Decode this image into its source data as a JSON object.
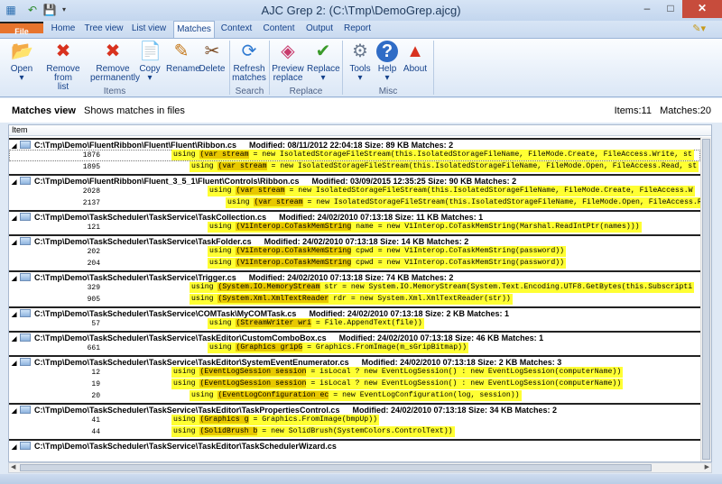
{
  "window": {
    "title": "AJC Grep 2:   (C:\\Tmp\\DemoGrep.ajcg)",
    "minimize": "–",
    "maximize": "□",
    "close": "✕"
  },
  "quick_access": [
    "save-icon",
    "undo-icon",
    "dropdown-icon"
  ],
  "tabs": [
    {
      "label": "File"
    },
    {
      "label": "Home"
    },
    {
      "label": "Tree view"
    },
    {
      "label": "List view"
    },
    {
      "label": "Matches"
    },
    {
      "label": "Context"
    },
    {
      "label": "Content"
    },
    {
      "label": "Output"
    },
    {
      "label": "Report"
    }
  ],
  "ribbon": {
    "items": [
      {
        "label": "Open",
        "label2": "▾",
        "icon": "open-icon",
        "glyph": "📂"
      },
      {
        "label": "Remove from",
        "label2": "list",
        "icon": "remove-icon",
        "glyph": "✖"
      },
      {
        "label": "Remove",
        "label2": "permanently",
        "icon": "delete-permanently-icon",
        "glyph": "✖"
      },
      {
        "label": "Copy",
        "label2": "▾",
        "icon": "copy-icon",
        "glyph": "📄"
      },
      {
        "label": "Rename",
        "label2": "",
        "icon": "rename-icon",
        "glyph": "✎"
      },
      {
        "label": "Delete",
        "label2": "",
        "icon": "delete-icon",
        "glyph": "✂"
      },
      {
        "label": "Refresh",
        "label2": "matches",
        "icon": "refresh-icon",
        "glyph": "⟳"
      },
      {
        "label": "Preview",
        "label2": "replace",
        "icon": "preview-replace-icon",
        "glyph": "◈"
      },
      {
        "label": "Replace",
        "label2": "▾",
        "icon": "replace-icon",
        "glyph": "✔"
      },
      {
        "label": "Tools",
        "label2": "▾",
        "icon": "tools-icon",
        "glyph": "⚙"
      },
      {
        "label": "Help",
        "label2": "▾",
        "icon": "help-icon",
        "glyph": "?"
      },
      {
        "label": "About",
        "label2": "",
        "icon": "about-icon",
        "glyph": "▲"
      }
    ],
    "groups": [
      {
        "label": "Items"
      },
      {
        "label": "Search"
      },
      {
        "label": "Replace"
      },
      {
        "label": "Misc"
      }
    ]
  },
  "view": {
    "title": "Matches view",
    "subtitle": "Shows matches in files",
    "items_count": "Items:11",
    "matches_count": "Matches:20"
  },
  "list": {
    "column_header": "Item",
    "files": [
      {
        "path": "C:\\Tmp\\Demo\\FluentRibbon\\Fluent\\Fluent\\Ribbon.cs",
        "meta": "Modified: 08/11/2012 22:04:18   Size: 89 KB   Matches: 2",
        "matches": [
          {
            "line": "1876",
            "indent": 0,
            "pre": "using ",
            "hl": "(var stream",
            "post": " = new IsolatedStorageFileStream(this.IsolatedStorageFileName, FileMode.Create, FileAccess.Write, st"
          },
          {
            "line": "1895",
            "indent": 1,
            "pre": "using ",
            "hl": "(var stream",
            "post": " = new IsolatedStorageFileStream(this.IsolatedStorageFileName, FileMode.Open, FileAccess.Read, st"
          }
        ]
      },
      {
        "path": "C:\\Tmp\\Demo\\FluentRibbon\\Fluent_3_5_1\\Fluent\\Controls\\Ribbon.cs",
        "meta": "Modified: 03/09/2015 12:35:25   Size: 90 KB   Matches: 2",
        "matches": [
          {
            "line": "2028",
            "indent": 2,
            "pre": "using ",
            "hl": "(var stream",
            "post": " = new IsolatedStorageFileStream(this.IsolatedStorageFileName, FileMode.Create, FileAccess.W"
          },
          {
            "line": "2137",
            "indent": 3,
            "pre": "using ",
            "hl": "(var stream",
            "post": " = new IsolatedStorageFileStream(this.IsolatedStorageFileName, FileMode.Open, FileAccess.R"
          }
        ]
      },
      {
        "path": "C:\\Tmp\\Demo\\TaskScheduler\\TaskService\\TaskCollection.cs",
        "meta": "Modified: 24/02/2010 07:13:18   Size: 11 KB   Matches: 1",
        "matches": [
          {
            "line": "121",
            "indent": 2,
            "pre": "using ",
            "hl": "(V1Interop.CoTaskMemString",
            "post": " name = new V1Interop.CoTaskMemString(Marshal.ReadIntPtr(names)))"
          }
        ]
      },
      {
        "path": "C:\\Tmp\\Demo\\TaskScheduler\\TaskService\\TaskFolder.cs",
        "meta": "Modified: 24/02/2010 07:13:18   Size: 14 KB   Matches: 2",
        "matches": [
          {
            "line": "202",
            "indent": 2,
            "pre": "using ",
            "hl": "(V1Interop.CoTaskMemString",
            "post": " cpwd = new V1Interop.CoTaskMemString(password))"
          },
          {
            "line": "204",
            "indent": 2,
            "pre": "using ",
            "hl": "(V1Interop.CoTaskMemString",
            "post": " cpwd = new V1Interop.CoTaskMemString(password))"
          }
        ]
      },
      {
        "path": "C:\\Tmp\\Demo\\TaskScheduler\\TaskService\\Trigger.cs",
        "meta": "Modified: 24/02/2010 07:13:18   Size: 74 KB   Matches: 2",
        "matches": [
          {
            "line": "329",
            "indent": 1,
            "pre": "using ",
            "hl": "(System.IO.MemoryStream",
            "post": " str = new System.IO.MemoryStream(System.Text.Encoding.UTF8.GetBytes(this.Subscripti"
          },
          {
            "line": "905",
            "indent": 1,
            "pre": "using ",
            "hl": "(System.Xml.XmlTextReader",
            "post": " rdr = new System.Xml.XmlTextReader(str))"
          }
        ]
      },
      {
        "path": "C:\\Tmp\\Demo\\TaskScheduler\\TaskService\\COMTask\\MyCOMTask.cs",
        "meta": "Modified: 24/02/2010 07:13:18   Size: 2 KB   Matches: 1",
        "matches": [
          {
            "line": "57",
            "indent": 2,
            "pre": "using ",
            "hl": "(StreamWriter wri",
            "post": " = File.AppendText(file))"
          }
        ]
      },
      {
        "path": "C:\\Tmp\\Demo\\TaskScheduler\\TaskService\\TaskEditor\\CustomComboBox.cs",
        "meta": "Modified: 24/02/2010 07:13:18   Size: 46 KB   Matches: 1",
        "matches": [
          {
            "line": "661",
            "indent": 2,
            "pre": "using ",
            "hl": "(Graphics gripG",
            "post": " = Graphics.FromImage(m_sGripBitmap))"
          }
        ]
      },
      {
        "path": "C:\\Tmp\\Demo\\TaskScheduler\\TaskService\\TaskEditor\\SystemEventEnumerator.cs",
        "meta": "Modified: 24/02/2010 07:13:18   Size: 2 KB   Matches: 3",
        "matches": [
          {
            "line": "12",
            "indent": 0,
            "pre": "using ",
            "hl": "(EventLogSession session",
            "post": " = isLocal ? new EventLogSession() : new EventLogSession(computerName))"
          },
          {
            "line": "19",
            "indent": 0,
            "pre": "using ",
            "hl": "(EventLogSession session",
            "post": " = isLocal ? new EventLogSession() : new EventLogSession(computerName))"
          },
          {
            "line": "20",
            "indent": 1,
            "pre": "using ",
            "hl": "(EventLogConfiguration ec",
            "post": " = new EventLogConfiguration(log, session))"
          }
        ]
      },
      {
        "path": "C:\\Tmp\\Demo\\TaskScheduler\\TaskService\\TaskEditor\\TaskPropertiesControl.cs",
        "meta": "Modified: 24/02/2010 07:13:18   Size: 34 KB   Matches: 2",
        "matches": [
          {
            "line": "41",
            "indent": 0,
            "pre": "using ",
            "hl": "(Graphics g",
            "post": " = Graphics.FromImage(bmpUp))"
          },
          {
            "line": "44",
            "indent": 0,
            "pre": "using ",
            "hl": "(SolidBrush b",
            "post": " = new SolidBrush(SystemColors.ControlText))"
          }
        ]
      },
      {
        "path": "C:\\Tmp\\Demo\\TaskScheduler\\TaskService\\TaskEditor\\TaskSchedulerWizard.cs",
        "meta": "",
        "matches": []
      }
    ]
  }
}
